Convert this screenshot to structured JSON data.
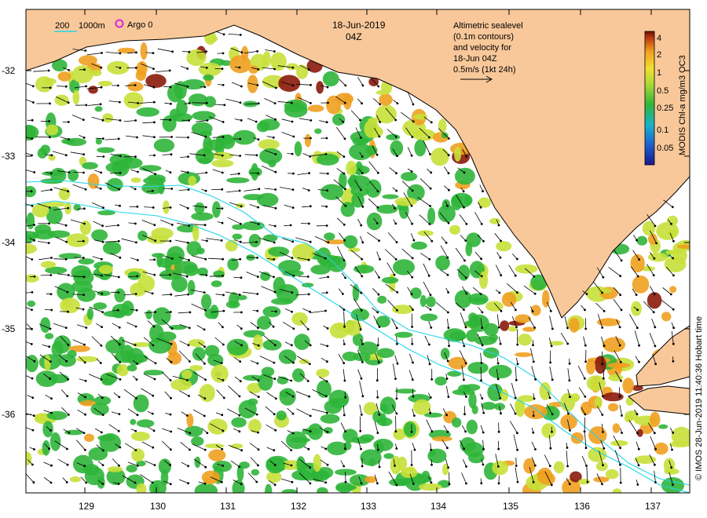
{
  "map": {
    "date": "18-Jun-2019",
    "time": "04Z",
    "depth_legend": {
      "shallow": "200",
      "deep": "1000m"
    },
    "argo_label": "Argo 0",
    "sealevel_caption": [
      "Altimetric sealevel",
      "(0.1m contours)",
      "and velocity for",
      "18-Jun 04Z",
      "0.5m/s (1kt 24h)"
    ],
    "colorbar": {
      "title": "MODIS Chl-a mg/m3 OC3",
      "ticks": [
        "4",
        "2",
        "1",
        "0.5",
        "0.25",
        "0.1",
        "0.05"
      ]
    },
    "credit": "© IMOS 28-Jun-2019 11:40:36 Hobart time",
    "lat_ticks": [
      "-32",
      "-33",
      "-34",
      "-35",
      "-36"
    ],
    "lon_ticks": [
      "129",
      "130",
      "131",
      "132",
      "133",
      "134",
      "135",
      "136",
      "137"
    ],
    "colors": {
      "land": "#f9c89a",
      "chl_low": "#2fb53a",
      "chl_mid": "#c8e03a",
      "chl_high": "#f0a020",
      "chl_max": "#8a1a0a",
      "isobath": "#22d6e8"
    }
  }
}
